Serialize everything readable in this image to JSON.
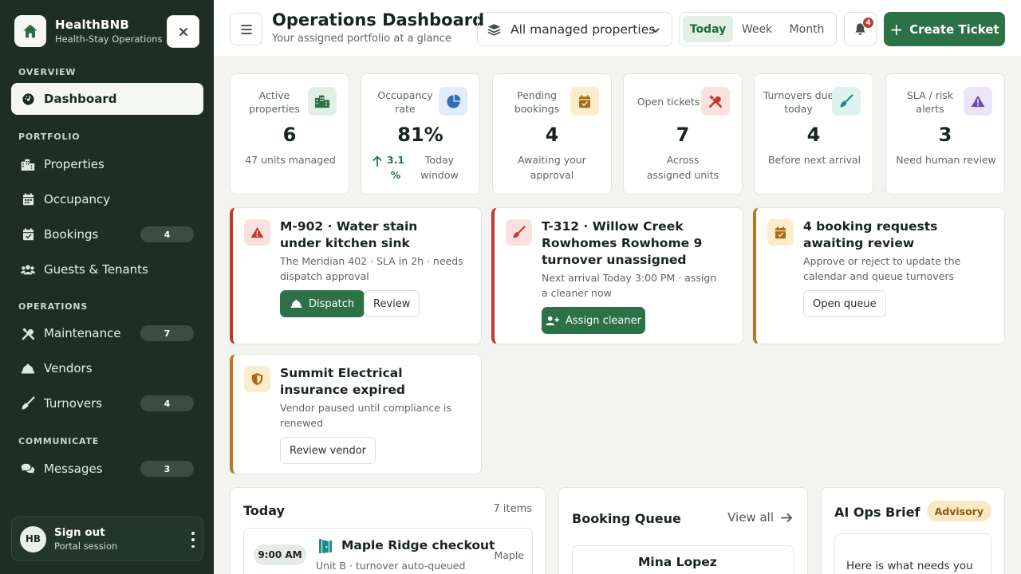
{
  "brand": {
    "name": "HealthBNB",
    "subtitle": "Health-Stay Operations"
  },
  "sidebar": {
    "sections": {
      "overview": "OVERVIEW",
      "portfolio": "PORTFOLIO",
      "operations": "OPERATIONS",
      "communicate": "COMMUNICATE"
    },
    "items": [
      {
        "label": "Dashboard",
        "icon": "gauge-icon",
        "active": true
      },
      {
        "label": "Properties",
        "icon": "city-icon"
      },
      {
        "label": "Occupancy",
        "icon": "calendar-icon"
      },
      {
        "label": "Bookings",
        "icon": "calendar-check-icon",
        "badge": "4"
      },
      {
        "label": "Guests & Tenants",
        "icon": "users-icon"
      },
      {
        "label": "Maintenance",
        "icon": "tools-icon",
        "badge": "7"
      },
      {
        "label": "Vendors",
        "icon": "hard-hat-icon"
      },
      {
        "label": "Turnovers",
        "icon": "broom-icon",
        "badge": "4"
      },
      {
        "label": "Messages",
        "icon": "comments-icon",
        "badge": "3"
      }
    ],
    "user": {
      "initials": "HB",
      "name": "Sign out",
      "subtitle": "Portal session"
    }
  },
  "header": {
    "title": "Operations Dashboard",
    "subtitle": "Your assigned portfolio at a glance",
    "property_filter": "All managed properties",
    "ranges": [
      "Today",
      "Week",
      "Month"
    ],
    "active_range": "Today",
    "notification_count": "4",
    "create_label": "Create Ticket"
  },
  "kpis": [
    {
      "label": "Active properties",
      "value": "6",
      "sub": "47 units managed",
      "icon": "building-icon",
      "color": "#2d7146",
      "bg": "#e3efe6"
    },
    {
      "label": "Occupancy rate",
      "value": "81%",
      "trend": "3.1 %",
      "sub": "Today window",
      "icon": "pie-chart-icon",
      "color": "#2f6db5",
      "bg": "#e2ecf7"
    },
    {
      "label": "Pending bookings",
      "value": "4",
      "sub": "Awaiting your approval",
      "icon": "calendar-check-icon",
      "color": "#a86b12",
      "bg": "#fbeccb"
    },
    {
      "label": "Open tickets",
      "value": "7",
      "sub": "Across assigned units",
      "icon": "tools-icon",
      "color": "#c0392b",
      "bg": "#f9e1de"
    },
    {
      "label": "Turnovers due today",
      "value": "4",
      "sub": "Before next arrival",
      "icon": "broom-icon",
      "color": "#1f8a86",
      "bg": "#def2f0"
    },
    {
      "label": "SLA / risk alerts",
      "value": "3",
      "sub": "Need human review",
      "icon": "warning-icon",
      "color": "#6f4bb0",
      "bg": "#ece4f7"
    }
  ],
  "alerts": [
    {
      "title": "M-902 · Water stain under kitchen sink",
      "desc": "The Meridian 402 · SLA in 2h · needs dispatch approval",
      "primary": "Dispatch",
      "secondary": "Review",
      "icon": "warning-icon"
    },
    {
      "title": "T-312 · Willow Creek Rowhomes Rowhome 9 turnover unassigned",
      "desc": "Next arrival Today 3:00 PM · assign a cleaner now",
      "primary": "Assign cleaner",
      "icon": "broom-icon"
    },
    {
      "title": "4 booking requests awaiting review",
      "desc": "Approve or reject to update the calendar and queue turnovers",
      "secondary": "Open queue",
      "icon": "calendar-check-icon"
    },
    {
      "title": "Summit Electrical insurance expired",
      "desc": "Vendor paused until compliance is renewed",
      "secondary": "Review vendor",
      "icon": "shield-icon"
    }
  ],
  "today": {
    "title": "Today",
    "count": "7 items",
    "first": {
      "time": "9:00 AM",
      "title": "Maple Ridge checkout",
      "sub": "Unit B · turnover auto-queued",
      "tag": "Maple"
    }
  },
  "booking_queue": {
    "title": "Booking Queue",
    "view_all": "View all",
    "first_name": "Mina Lopez"
  },
  "ai_brief": {
    "title": "AI Ops Brief",
    "badge": "Advisory",
    "text": "Here is what needs you"
  }
}
